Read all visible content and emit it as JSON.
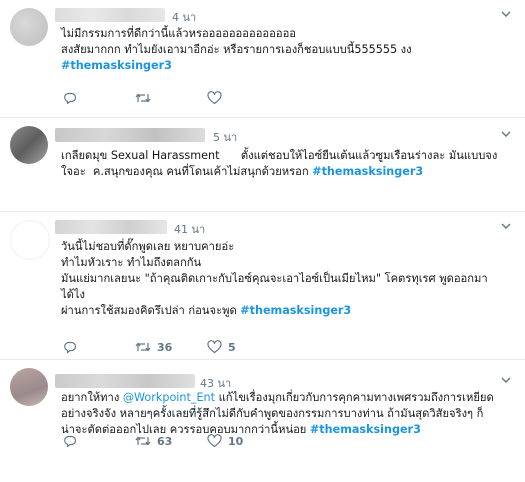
{
  "tweets": [
    {
      "time": "4 นา",
      "lines": [
        [
          {
            "t": "text",
            "v": "ไม่มีกรรมการที่ดีกว่านี้แล้วหรออออออออออออออ"
          }
        ],
        [
          {
            "t": "text",
            "v": "สงสัยมากกก ทำไมยังเอามาอีกอ่ะ หรือรายการเองก็ชอบแบบนี้555555 งง"
          }
        ],
        [
          {
            "t": "tag",
            "v": "#themasksinger3"
          }
        ]
      ],
      "actions": {
        "reply_count": "",
        "retweet_count": "",
        "like_count": ""
      }
    },
    {
      "time": "5 นา",
      "lines": [
        [
          {
            "t": "text",
            "v": "เกลียดมุข Sexual Harassment      ตั้งแต่ชอบให้ไอซ์ยืนเต้นแล้วซูมเรือนร่างละ มันแบบจง"
          }
        ],
        [
          {
            "t": "text",
            "v": "ใจอะ  ค.สนุกของคุณ คนที่โดนเค้าไม่สนุกด้วยหรอก "
          },
          {
            "t": "tag",
            "v": "#themasksinger3"
          }
        ]
      ],
      "actions": {
        "reply_count": "",
        "retweet_count": "",
        "like_count": ""
      }
    },
    {
      "time": "41 นา",
      "lines": [
        [
          {
            "t": "text",
            "v": "วันนี้ไม่ชอบที่ดั๊กพูดเลย หยาบคายอ่ะ"
          }
        ],
        [
          {
            "t": "text",
            "v": "ทำไมหัวเราะ ทำไมถึงตลกกัน"
          }
        ],
        [
          {
            "t": "text",
            "v": "มันแย่มากเลยนะ \"ถ้าคุณติดเกาะกับไอซ์คุณจะเอาไอซ์เป็นเมียไหม\" โคตรทุเรศ พูดออกมา"
          }
        ],
        [
          {
            "t": "text",
            "v": "ได้ไง"
          }
        ],
        [
          {
            "t": "text",
            "v": "ผ่านการใช้สมองคิดรึเปล่า ก่อนจะพูด "
          },
          {
            "t": "tag",
            "v": "#themasksinger3"
          }
        ]
      ],
      "actions": {
        "reply_count": "",
        "retweet_count": "36",
        "like_count": "5"
      }
    },
    {
      "time": "43 นา",
      "lines": [
        [
          {
            "t": "text",
            "v": "อยากให้ทาง "
          },
          {
            "t": "mention",
            "v": "@Workpoint_Ent"
          },
          {
            "t": "text",
            "v": " แก้ไขเรื่องมุกเกี่ยวกับการคุกคามทางเพศรวมถึงการเหยียด"
          }
        ],
        [
          {
            "t": "text",
            "v": "อย่างจริงจัง หลายๆครั้งเลยที่รู้สึกไม่ดีกับคำพูดของกรรมการบางท่าน ถ้ามันสุดวิสัยจริงๆ ก็"
          }
        ],
        [
          {
            "t": "text",
            "v": "น่าจะตัดต่อออกไปเลย ควรรอบคอบมากกว่านี้หน่อย "
          },
          {
            "t": "tag",
            "v": "#themasksinger3"
          }
        ]
      ],
      "actions": {
        "reply_count": "",
        "retweet_count": "63",
        "like_count": "10"
      }
    }
  ],
  "icons": {
    "reply": "reply-icon",
    "retweet": "retweet-icon",
    "like": "like-icon",
    "caret": "chevron-down-icon"
  },
  "colors": {
    "hashtag": "#1b95e0",
    "meta": "#657786",
    "divider": "#e6ecf0"
  }
}
